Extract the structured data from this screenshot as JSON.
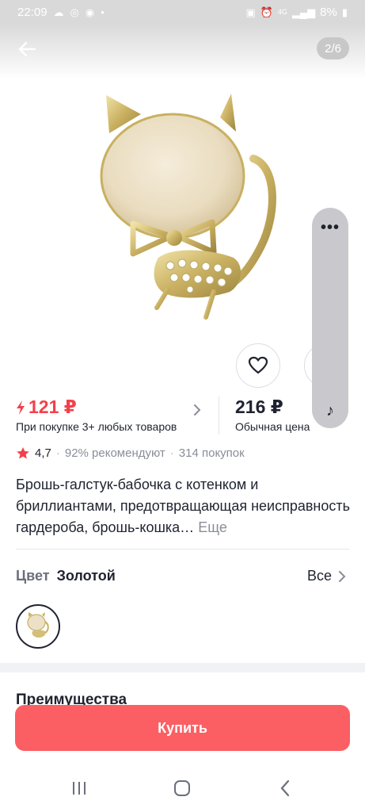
{
  "status_bar": {
    "time": "22:09",
    "network": "4G",
    "battery": "8%"
  },
  "gallery": {
    "counter": "2/6"
  },
  "price": {
    "promo_value": "121 ₽",
    "promo_note": "При покупке 3+ любых товаров",
    "regular_value": "216 ₽",
    "regular_note": "Обычная цена"
  },
  "rating": {
    "value": "4,7",
    "recommend": "92% рекомендуют",
    "purchases": "314 покупок"
  },
  "product": {
    "title": "Брошь-галстук-бабочка с котенком и бриллиантами, предотвращающая неисправность гардероба, брошь-кошка…",
    "more_label": "Еще"
  },
  "color": {
    "label": "Цвет",
    "value": "Золотой",
    "all_label": "Все"
  },
  "section": {
    "title": "Преимущества"
  },
  "buy_button": {
    "label": "Купить"
  },
  "colors": {
    "accent": "#f2414b",
    "buy_button": "#fb5f63",
    "text": "#1f2330",
    "muted": "#8a8d99"
  }
}
